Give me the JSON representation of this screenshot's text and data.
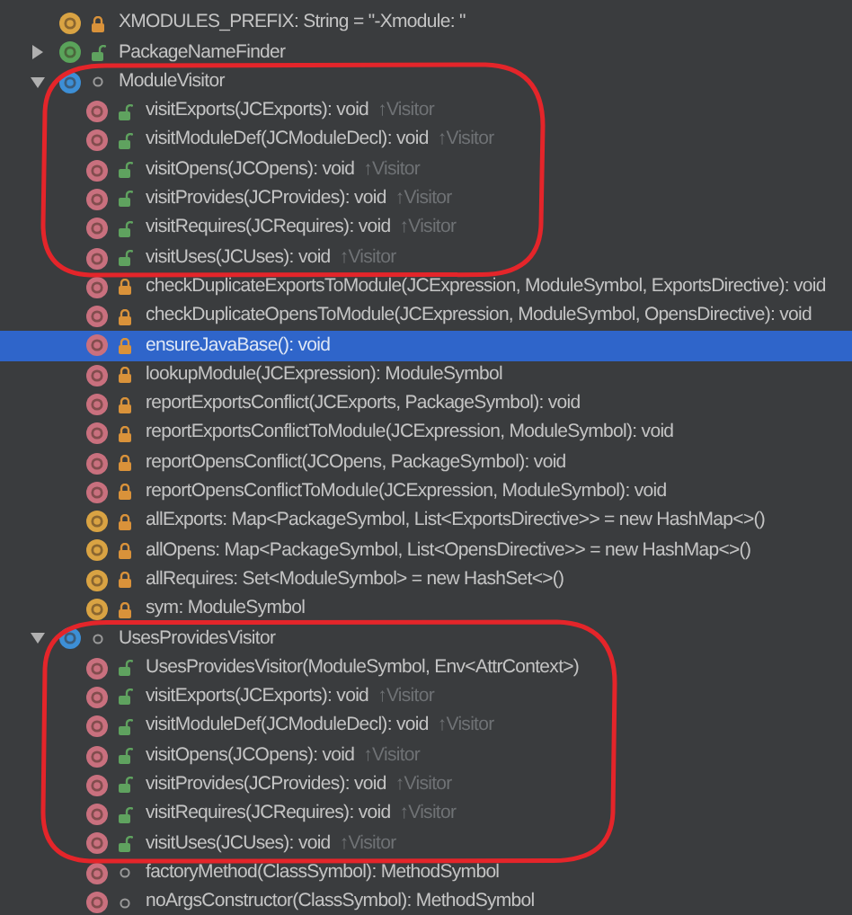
{
  "tree": [
    {
      "kind": "field",
      "private": true,
      "public": false,
      "label": "XMODULES_PREFIX: String = \"-Xmodule: \"",
      "selected": false
    },
    {
      "kind": "interface",
      "private": false,
      "public": true,
      "label": "PackageNameFinder",
      "expanded": false,
      "selected": false
    },
    {
      "kind": "class",
      "private": false,
      "public": false,
      "label": "ModuleVisitor",
      "expanded": true,
      "selected": false,
      "children": [
        {
          "kind": "method",
          "private": false,
          "public": true,
          "label": "visitExports(JCExports): void",
          "suffix": "↑Visitor",
          "selected": false
        },
        {
          "kind": "method",
          "private": false,
          "public": true,
          "label": "visitModuleDef(JCModuleDecl): void",
          "suffix": "↑Visitor",
          "selected": false
        },
        {
          "kind": "method",
          "private": false,
          "public": true,
          "label": "visitOpens(JCOpens): void",
          "suffix": "↑Visitor",
          "selected": false
        },
        {
          "kind": "method",
          "private": false,
          "public": true,
          "label": "visitProvides(JCProvides): void",
          "suffix": "↑Visitor",
          "selected": false
        },
        {
          "kind": "method",
          "private": false,
          "public": true,
          "label": "visitRequires(JCRequires): void",
          "suffix": "↑Visitor",
          "selected": false
        },
        {
          "kind": "method",
          "private": false,
          "public": true,
          "label": "visitUses(JCUses): void",
          "suffix": "↑Visitor",
          "selected": false
        },
        {
          "kind": "method",
          "private": true,
          "public": false,
          "label": "checkDuplicateExportsToModule(JCExpression, ModuleSymbol, ExportsDirective): void",
          "selected": false
        },
        {
          "kind": "method",
          "private": true,
          "public": false,
          "label": "checkDuplicateOpensToModule(JCExpression, ModuleSymbol, OpensDirective): void",
          "selected": false
        },
        {
          "kind": "method",
          "private": true,
          "public": false,
          "label": "ensureJavaBase(): void",
          "selected": true
        },
        {
          "kind": "method",
          "private": true,
          "public": false,
          "label": "lookupModule(JCExpression): ModuleSymbol",
          "selected": false
        },
        {
          "kind": "method",
          "private": true,
          "public": false,
          "label": "reportExportsConflict(JCExports, PackageSymbol): void",
          "selected": false
        },
        {
          "kind": "method",
          "private": true,
          "public": false,
          "label": "reportExportsConflictToModule(JCExpression, ModuleSymbol): void",
          "selected": false
        },
        {
          "kind": "method",
          "private": true,
          "public": false,
          "label": "reportOpensConflict(JCOpens, PackageSymbol): void",
          "selected": false
        },
        {
          "kind": "method",
          "private": true,
          "public": false,
          "label": "reportOpensConflictToModule(JCExpression, ModuleSymbol): void",
          "selected": false
        },
        {
          "kind": "field",
          "private": true,
          "public": false,
          "label": "allExports: Map<PackageSymbol, List<ExportsDirective>> = new HashMap<>()",
          "selected": false
        },
        {
          "kind": "field",
          "private": true,
          "public": false,
          "label": "allOpens: Map<PackageSymbol, List<OpensDirective>> = new HashMap<>()",
          "selected": false
        },
        {
          "kind": "field",
          "private": true,
          "public": false,
          "label": "allRequires: Set<ModuleSymbol> = new HashSet<>()",
          "selected": false
        },
        {
          "kind": "field",
          "private": true,
          "public": false,
          "label": "sym: ModuleSymbol",
          "selected": false
        }
      ]
    },
    {
      "kind": "class",
      "private": false,
      "public": false,
      "label": "UsesProvidesVisitor",
      "expanded": true,
      "selected": false,
      "children": [
        {
          "kind": "method",
          "private": false,
          "public": true,
          "label": "UsesProvidesVisitor(ModuleSymbol, Env<AttrContext>)",
          "selected": false
        },
        {
          "kind": "method",
          "private": false,
          "public": true,
          "label": "visitExports(JCExports): void",
          "suffix": "↑Visitor",
          "selected": false
        },
        {
          "kind": "method",
          "private": false,
          "public": true,
          "label": "visitModuleDef(JCModuleDecl): void",
          "suffix": "↑Visitor",
          "selected": false
        },
        {
          "kind": "method",
          "private": false,
          "public": true,
          "label": "visitOpens(JCOpens): void",
          "suffix": "↑Visitor",
          "selected": false
        },
        {
          "kind": "method",
          "private": false,
          "public": true,
          "label": "visitProvides(JCProvides): void",
          "suffix": "↑Visitor",
          "selected": false
        },
        {
          "kind": "method",
          "private": false,
          "public": true,
          "label": "visitRequires(JCRequires): void",
          "suffix": "↑Visitor",
          "selected": false
        },
        {
          "kind": "method",
          "private": false,
          "public": true,
          "label": "visitUses(JCUses): void",
          "suffix": "↑Visitor",
          "selected": false
        },
        {
          "kind": "method",
          "private": false,
          "public": false,
          "label": "factoryMethod(ClassSymbol): MethodSymbol",
          "selected": false
        },
        {
          "kind": "method",
          "private": false,
          "public": false,
          "label": "noArgsConstructor(ClassSymbol): MethodSymbol",
          "selected": false
        }
      ]
    }
  ]
}
